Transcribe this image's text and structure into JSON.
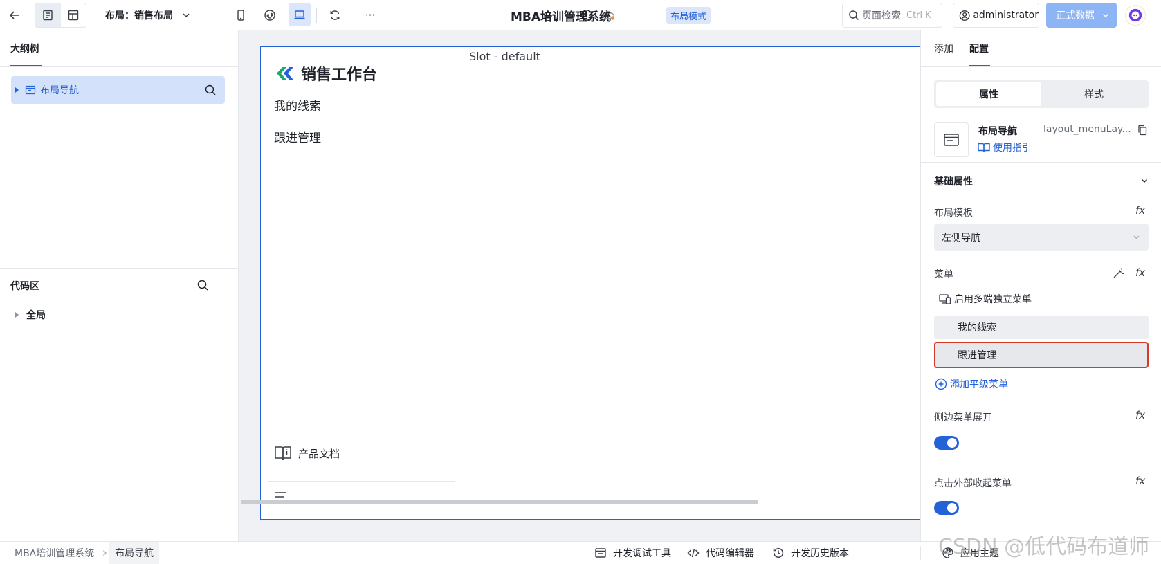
{
  "topbar": {
    "layout_label": "布局：销售布局",
    "app_title": "MBA培训管理系统",
    "mode_tag": "布局模式",
    "search_placeholder": "页面检索",
    "search_shortcut": "Ctrl K",
    "user_name": "administrator",
    "data_env": "正式数据",
    "more_glyph": "···"
  },
  "left_panel": {
    "outline_tab": "大纲树",
    "tree_node": "布局导航",
    "code_section": "代码区",
    "code_node": "全局"
  },
  "canvas": {
    "brand": "销售工作台",
    "nav_items": [
      "我的线索",
      "跟进管理"
    ],
    "docs_link": "产品文档",
    "slot_text": "Slot - default"
  },
  "right_panel": {
    "tabs": [
      "添加",
      "配置"
    ],
    "segments": [
      "属性",
      "样式"
    ],
    "component_name": "布局导航",
    "component_id": "layout_menuLay...",
    "guide_link": "使用指引",
    "section_basic": "基础属性",
    "prop_template": "布局模板",
    "template_value": "左侧导航",
    "prop_menu": "菜单",
    "multi_menu": "启用多端独立菜单",
    "menu_items": [
      "我的线索",
      "跟进管理"
    ],
    "add_menu": "添加平级菜单",
    "prop_expand": "侧边菜单展开",
    "prop_collapse_outside": "点击外部收起菜单",
    "fx_label": "fx"
  },
  "statusbar": {
    "breadcrumb": [
      "MBA培训管理系统",
      "布局导航"
    ],
    "tools": [
      "开发调试工具",
      "代码编辑器",
      "开发历史版本",
      "应用主题"
    ]
  },
  "watermark": "CSDN @低代码布道师",
  "colors": {
    "accent": "#2462d7",
    "accent_light": "#d3e1fa",
    "highlight_border": "#d93a25",
    "canvas_bg": "#eff1f5"
  }
}
